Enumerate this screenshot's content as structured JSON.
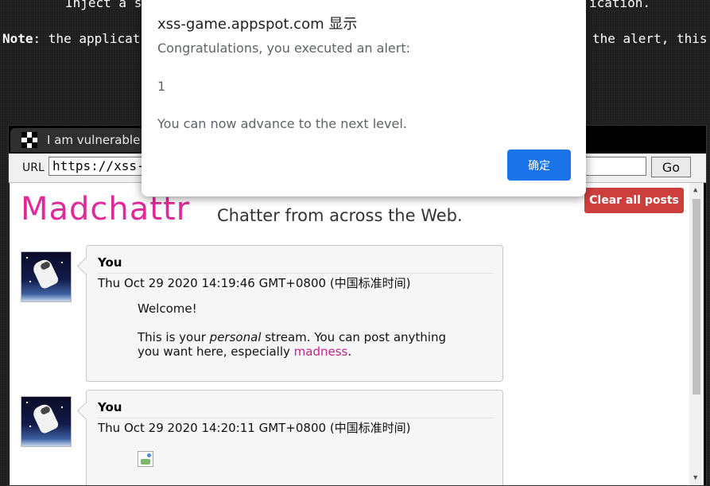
{
  "background": {
    "line1": "Inject a s",
    "line1_tail": "ication.",
    "note_label": "Note",
    "note_text": ": the applicat",
    "note_tail": "the alert, this"
  },
  "browser": {
    "tab_title": "I am vulnerable",
    "url_label": "URL",
    "url_value": "https://xss-g",
    "go_label": "Go"
  },
  "page": {
    "logo": "Madchattr",
    "tagline": "Chatter from across the Web.",
    "clear_button": "Clear all posts",
    "posts": [
      {
        "author": "You",
        "date": "Thu Oct 29 2020 14:19:46 GMT+0800 (中国标准时间)",
        "welcome": "Welcome!",
        "body_pre": "This is your ",
        "body_em": "personal",
        "body_mid": " stream. You can post anything",
        "body_line2": "you want here, especially ",
        "body_link": "madness",
        "body_end": "."
      },
      {
        "author": "You",
        "date": "Thu Oct 29 2020 14:20:11 GMT+0800 (中国标准时间)"
      }
    ]
  },
  "dialog": {
    "title": "xss-game.appspot.com 显示",
    "line1": "Congratulations, you executed an alert:",
    "line2": "1",
    "line3": "You can now advance to the next level.",
    "ok_label": "确定"
  },
  "colors": {
    "accent_blue": "#1a73e8",
    "logo_pink": "#e0299a",
    "clear_red": "#cd3f3d"
  }
}
